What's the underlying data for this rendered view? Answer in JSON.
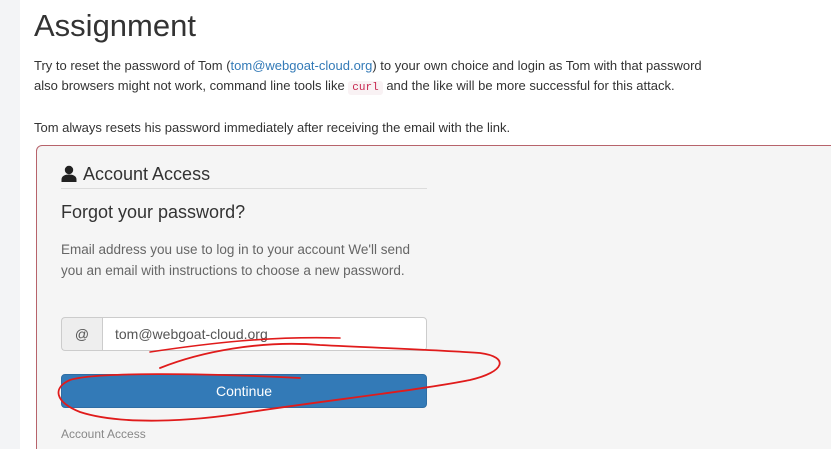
{
  "assignment": {
    "title": "Assignment",
    "intro_line1_before": "Try to reset the password of Tom (",
    "intro_email": "tom@webgoat-cloud.org",
    "intro_line1_after": ") to your own choice and login as Tom with that password",
    "intro_line2_before": "also browsers might not work, command line tools like ",
    "intro_code": "curl",
    "intro_line2_after": " and the like will be more successful for this attack.",
    "note": "Tom always resets his password immediately after receiving the email with the link."
  },
  "form": {
    "heading": "Account Access",
    "heading_icon": "person-icon",
    "subheading": "Forgot your password?",
    "instructions": "Email address you use to log in to your account We'll send you an email with instructions to choose a new password.",
    "addon": "@",
    "email_value": "tom@webgoat-cloud.org",
    "continue_label": "Continue",
    "footer_label": "Account Access"
  },
  "colors": {
    "panel_border": "#b7636b",
    "button": "#337ab7",
    "link": "#337ab7",
    "annotation": "#e01b1b"
  }
}
